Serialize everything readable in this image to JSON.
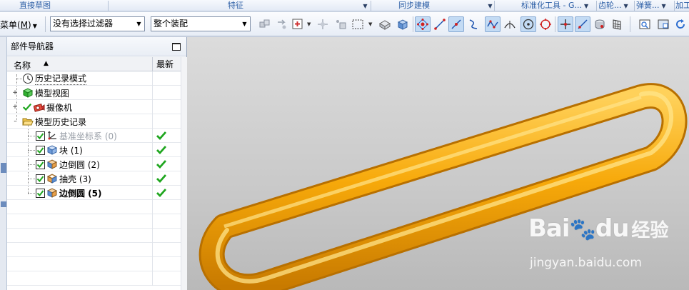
{
  "group_bar": {
    "groups": [
      {
        "label": "直接草图",
        "has_arrow": false
      },
      {
        "label": "特征",
        "has_arrow": true
      },
      {
        "label": "同步建模",
        "has_arrow": true
      },
      {
        "label": "标准化工具 - G...",
        "has_arrow": true
      },
      {
        "label": "齿轮...",
        "has_arrow": true
      },
      {
        "label": "弹簧...",
        "has_arrow": true
      },
      {
        "label": "加工",
        "has_arrow": false
      }
    ]
  },
  "toolbar": {
    "menu_label": "菜单(",
    "menu_key": "M",
    "menu_suffix": ")",
    "selection_filter": {
      "value": "没有选择过滤器"
    },
    "scope": {
      "value": "整个装配"
    },
    "icons": [
      "assembly-select-icon",
      "snap-arrow-icon",
      "add-point-icon",
      "move-handle-icon",
      "copy-object-icon",
      "rectangle-select-icon",
      "body-select-icon",
      "solid-cube-icon",
      "snap-points-icon",
      "line-tool-icon",
      "snap-line-icon",
      "intersection-curve-icon",
      "spline-icon",
      "tangent-point-icon",
      "center-point-icon",
      "quadrant-point-icon",
      "cross-point-icon",
      "slope-line-icon",
      "cylinder-icon",
      "grid-icon",
      "fit-view-icon",
      "zoom-window-icon",
      "refresh-icon"
    ]
  },
  "navigator": {
    "title": "部件导航器",
    "columns": {
      "name": "名称",
      "latest": "最新"
    },
    "rows": [
      {
        "label": "历史记录模式",
        "icon": "history-clock-icon",
        "latest": false,
        "style": "history"
      },
      {
        "label": "模型视图",
        "icon": "model-view-icon",
        "latest": false,
        "style": "normal",
        "expander": "+"
      },
      {
        "label": "摄像机",
        "icon": "camera-icon",
        "latest": false,
        "style": "normal",
        "expander": "+",
        "checked": true
      },
      {
        "label": "模型历史记录",
        "icon": "folder-open-icon",
        "latest": false,
        "style": "normal",
        "expander": "-"
      },
      {
        "label": "基准坐标系 (0)",
        "icon": "datum-csys-icon",
        "latest": true,
        "style": "gray",
        "checkbox": true
      },
      {
        "label": "块 (1)",
        "icon": "block-icon",
        "latest": true,
        "style": "normal",
        "checkbox": true
      },
      {
        "label": "边倒圆 (2)",
        "icon": "edge-blend-icon",
        "latest": true,
        "style": "normal",
        "checkbox": true
      },
      {
        "label": "抽壳 (3)",
        "icon": "shell-icon",
        "latest": true,
        "style": "normal",
        "checkbox": true
      },
      {
        "label": "边倒圆 (5)",
        "icon": "edge-blend-icon",
        "latest": true,
        "style": "bold",
        "checkbox": true
      }
    ]
  },
  "watermark": {
    "brand": "Bai",
    "brand_suffix": "经验",
    "url": "jingyan.baidu.com"
  },
  "colors": {
    "model_color": "#f7a90a",
    "check_green": "#1fa61f"
  }
}
